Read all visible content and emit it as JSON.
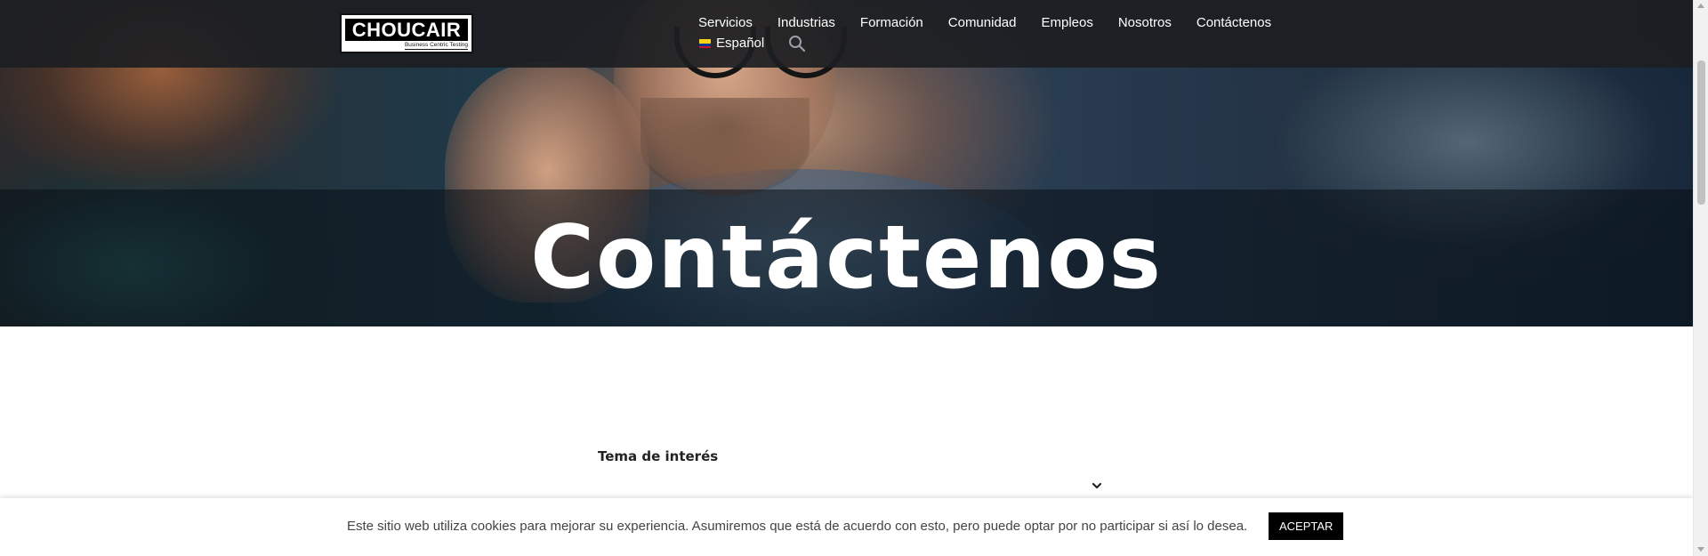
{
  "header": {
    "logo": {
      "brand": "CHOUCAIR",
      "tagline": "Business Centric Testing"
    },
    "nav": {
      "items": [
        {
          "label": "Servicios"
        },
        {
          "label": "Industrias"
        },
        {
          "label": "Formación"
        },
        {
          "label": "Comunidad"
        },
        {
          "label": "Empleos"
        },
        {
          "label": "Nosotros"
        },
        {
          "label": "Contáctenos"
        }
      ]
    },
    "language": {
      "label": "Español",
      "flag_colors": [
        "#fcd116",
        "#003893",
        "#ce1126"
      ]
    },
    "search_icon": "search-icon"
  },
  "hero": {
    "title": "Contáctenos"
  },
  "form": {
    "topic_label": "Tema de interés",
    "topic_value": "",
    "dropdown_icon": "chevron-down-icon"
  },
  "cookie_notice": {
    "text": "Este sitio web utiliza cookies para mejorar su experiencia. Asumiremos que está de acuerdo con esto, pero puede optar por no participar si así lo desea.",
    "accept_label": "ACEPTAR"
  },
  "colors": {
    "header_bg": "#1c1e22",
    "text_light": "#ffffff",
    "accept_bg": "#000000"
  }
}
